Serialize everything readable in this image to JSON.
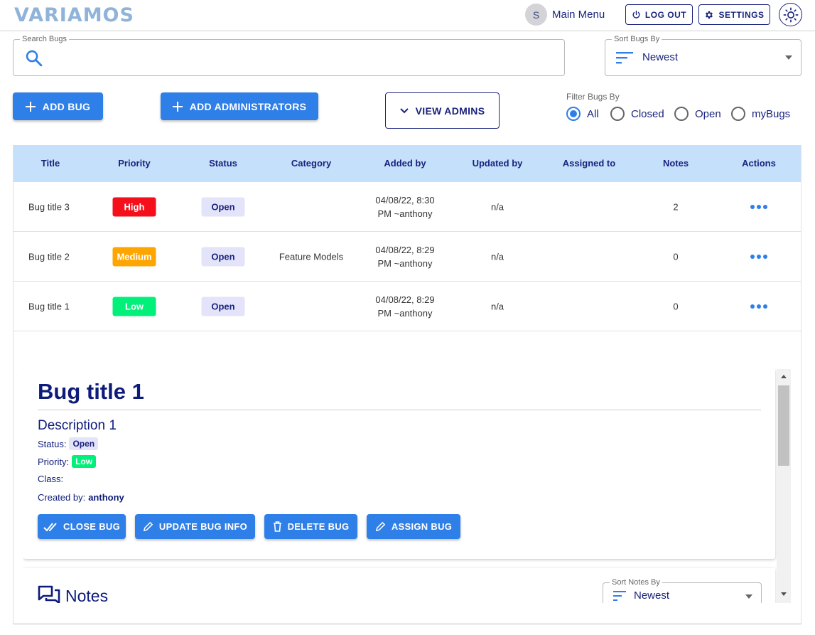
{
  "header": {
    "logo": "VARIAMOS",
    "avatar_initial": "S",
    "main_menu": "Main Menu",
    "logout_label": "LOG OUT",
    "settings_label": "SETTINGS"
  },
  "search": {
    "legend": "Search Bugs",
    "value": ""
  },
  "sort": {
    "legend": "Sort Bugs By",
    "value": "Newest"
  },
  "actions": {
    "add_bug": "ADD BUG",
    "add_admins": "ADD ADMINISTRATORS",
    "view_admins": "VIEW ADMINS"
  },
  "filter": {
    "label": "Filter Bugs By",
    "options": [
      "All",
      "Closed",
      "Open",
      "myBugs"
    ],
    "selected": "All"
  },
  "colors": {
    "primary": "#2f7fe8",
    "navy": "#1a237e",
    "header_bg": "#c5e0fb",
    "high": "#f50f1a",
    "medium": "#ffa500",
    "low": "#00e676",
    "open_chip": "#e3e3fa"
  },
  "table": {
    "columns": [
      "Title",
      "Priority",
      "Status",
      "Category",
      "Added by",
      "Updated by",
      "Assigned to",
      "Notes",
      "Actions"
    ],
    "rows": [
      {
        "title": "Bug title 3",
        "priority": "High",
        "status": "Open",
        "category": "",
        "added_line1": "04/08/22, 8:30",
        "added_line2": "PM ~anthony",
        "updated": "n/a",
        "assigned": "",
        "notes": "2"
      },
      {
        "title": "Bug title 2",
        "priority": "Medium",
        "status": "Open",
        "category": "Feature Models",
        "added_line1": "04/08/22, 8:29",
        "added_line2": "PM ~anthony",
        "updated": "n/a",
        "assigned": "",
        "notes": "0"
      },
      {
        "title": "Bug title 1",
        "priority": "Low",
        "status": "Open",
        "category": "",
        "added_line1": "04/08/22, 8:29",
        "added_line2": "PM ~anthony",
        "updated": "n/a",
        "assigned": "",
        "notes": "0"
      }
    ]
  },
  "detail": {
    "title": "Bug title 1",
    "description": "Description 1",
    "status_label": "Status:",
    "status": "Open",
    "priority_label": "Priority:",
    "priority": "Low",
    "class_label": "Class:",
    "created_label": "Created by:",
    "created_by": "anthony",
    "close_bug": "CLOSE BUG",
    "update_info": "UPDATE BUG INFO",
    "delete_bug": "DELETE BUG",
    "assign_bug": "ASSIGN BUG"
  },
  "notes": {
    "title": "Notes",
    "sort_legend": "Sort Notes By",
    "sort_value": "Newest"
  }
}
